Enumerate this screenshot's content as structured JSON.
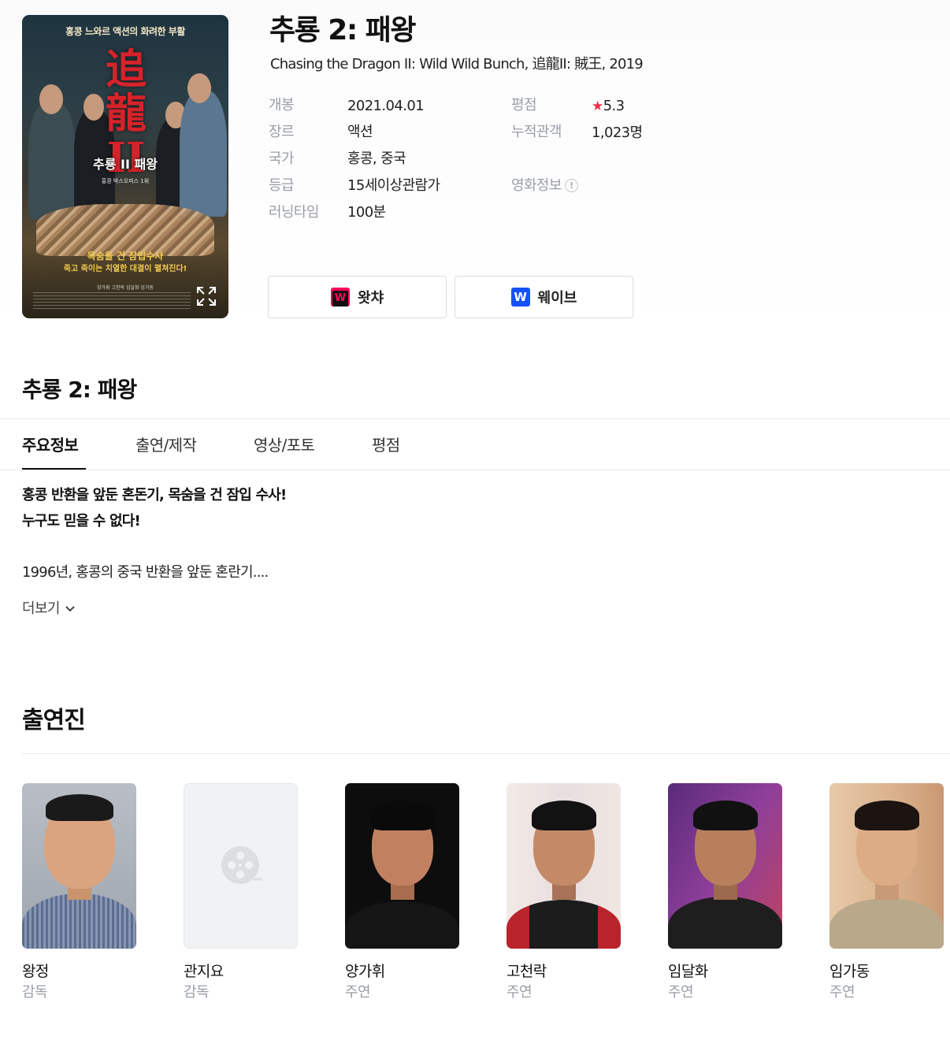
{
  "poster": {
    "tagline_top": "홍콩 느와르 액션의 화려한 부활",
    "title_glyph": "追\n龍\nII",
    "title_ko": "추룡 II 패왕",
    "subline": "홍콩 박스오피스 1위",
    "bottom_line1": "목숨을 건 잠입수사",
    "bottom_line2": "죽고 죽이는 치열한 대결이 펼쳐진다!",
    "credits": "양가휘  고천락  임달화  임가동"
  },
  "movie": {
    "title": "추룡 2: 패왕",
    "subtitle": "Chasing the Dragon II: Wild Wild Bunch, 追龍II: 賊王, 2019"
  },
  "info_left": [
    {
      "label": "개봉",
      "value": "2021.04.01"
    },
    {
      "label": "장르",
      "value": "액션"
    },
    {
      "label": "국가",
      "value": "홍콩, 중국"
    },
    {
      "label": "등급",
      "value": "15세이상관람가"
    },
    {
      "label": "러닝타임",
      "value": "100분"
    }
  ],
  "info_right": {
    "rating_label": "평점",
    "rating_value": "5.3",
    "audience_label": "누적관객",
    "audience_value": "1,023명",
    "movie_info_label": "영화정보"
  },
  "watch_buttons": [
    {
      "label": "왓챠",
      "logo_letter": "W",
      "logo_color": "#ff0558"
    },
    {
      "label": "웨이브",
      "logo_letter": "W",
      "logo_color": "#1351f9"
    }
  ],
  "section_title": "추룡 2: 패왕",
  "tabs": [
    "주요정보",
    "출연/제작",
    "영상/포토",
    "평점"
  ],
  "synopsis": {
    "line1": "홍콩 반환을 앞둔 혼돈기, 목숨을 건 잠입 수사!",
    "line2": "누구도 믿을 수 없다!",
    "body": "1996년, 홍콩의 중국 반환을 앞둔 혼란기....",
    "more": "더보기"
  },
  "cast_title": "출연진",
  "cast": [
    {
      "name": "왕정",
      "role": "감독",
      "photo": "person-photo"
    },
    {
      "name": "관지요",
      "role": "감독",
      "photo": "placeholder"
    },
    {
      "name": "양가휘",
      "role": "주연",
      "photo": "person-photo"
    },
    {
      "name": "고천락",
      "role": "주연",
      "photo": "person-photo"
    },
    {
      "name": "임달화",
      "role": "주연",
      "photo": "person-photo"
    },
    {
      "name": "임가동",
      "role": "주연",
      "photo": "person-photo"
    }
  ],
  "colors": {
    "star": "#f42b49",
    "label_gray": "#9a9ea4",
    "text_dark": "#111111"
  }
}
